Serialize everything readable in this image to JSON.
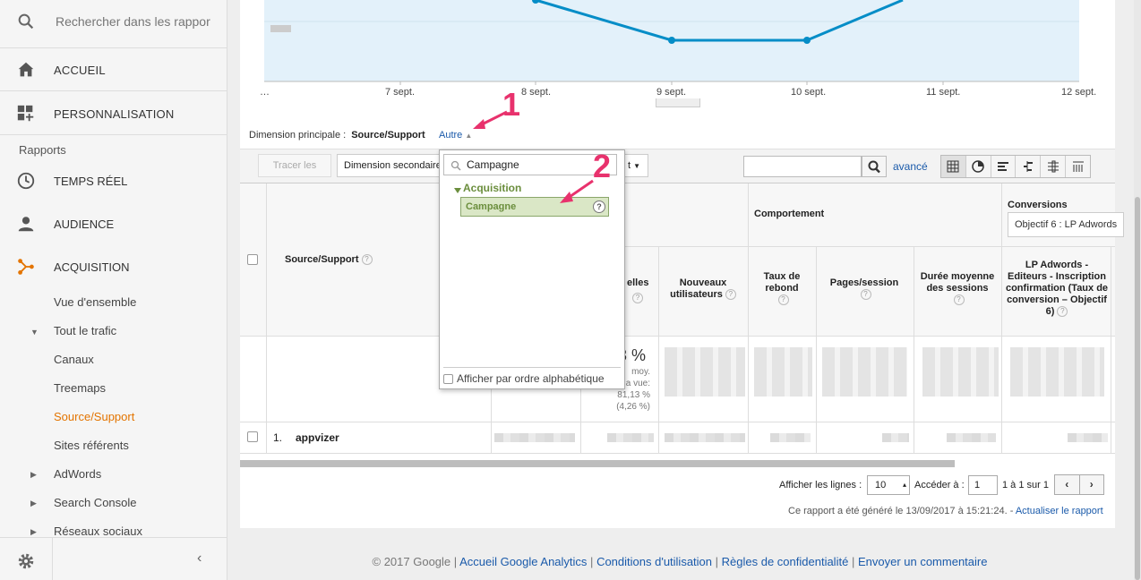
{
  "sidebar": {
    "search_placeholder": "Rechercher dans les rappor",
    "home": "ACCUEIL",
    "customization": "PERSONNALISATION",
    "reports_section": "Rapports",
    "realtime": "TEMPS RÉEL",
    "audience": "AUDIENCE",
    "acquisition": "ACQUISITION",
    "acq_sub": {
      "overview": "Vue d'ensemble",
      "all_traffic": "Tout le trafic",
      "channels": "Canaux",
      "treemaps": "Treemaps",
      "source_medium": "Source/Support",
      "referrals": "Sites référents",
      "adwords": "AdWords",
      "search_console": "Search Console",
      "social": "Réseaux sociaux"
    },
    "accent_color": "#e37400"
  },
  "chart": {
    "x_ticks": [
      "…",
      "7 sept.",
      "8 sept.",
      "9 sept.",
      "10 sept.",
      "11 sept.",
      "12 sept."
    ]
  },
  "dimension": {
    "label": "Dimension principale :",
    "value": "Source/Support",
    "other": "Autre"
  },
  "toolbar": {
    "plot_rows": "Tracer les lignes",
    "secondary_dimension": "Dimension secondaire",
    "type_fragment": "t",
    "advanced": "avancé"
  },
  "table": {
    "col_source": "Source/Support",
    "group_behavior": "Comportement",
    "group_conversions": "Conversions",
    "conv_select": "Objectif 6 : LP Adwords",
    "col_sessions_fragment": "elles",
    "col_new_users": "Nouveaux utilisateurs",
    "col_bounce": "Taux de rebond",
    "col_pages": "Pages/session",
    "col_duration": "Durée moyenne des sessions",
    "col_goal": "LP Adwords - Editeurs - Inscription confirmation (Taux de conversion – Objectif 6)",
    "total_pct": "3 %",
    "total_sub1": "moy.",
    "total_sub2": "a vue:",
    "total_sub3": "81,13 %",
    "total_sub4": "(4,26 %)",
    "row1_num": "1.",
    "row1_name": "appvizer"
  },
  "dropdown": {
    "search_value": "Campagne",
    "group": "Acquisition",
    "item": "Campagne",
    "alpha_label": "Afficher par ordre alphabétique"
  },
  "pager": {
    "show_rows": "Afficher les lignes :",
    "rows_value": "10",
    "go_to": "Accéder à :",
    "page_value": "1",
    "range": "1 à 1 sur 1"
  },
  "generated": {
    "text": "Ce rapport a été généré le 13/09/2017 à 15:21:24. -",
    "refresh": "Actualiser le rapport"
  },
  "footer": {
    "copyright": "© 2017 Google |",
    "home": "Accueil Google Analytics",
    "terms": "Conditions d'utilisation",
    "privacy": "Règles de confidentialité",
    "feedback": "Envoyer un commentaire",
    "sep": "|"
  },
  "annotations": [
    "1",
    "2"
  ]
}
